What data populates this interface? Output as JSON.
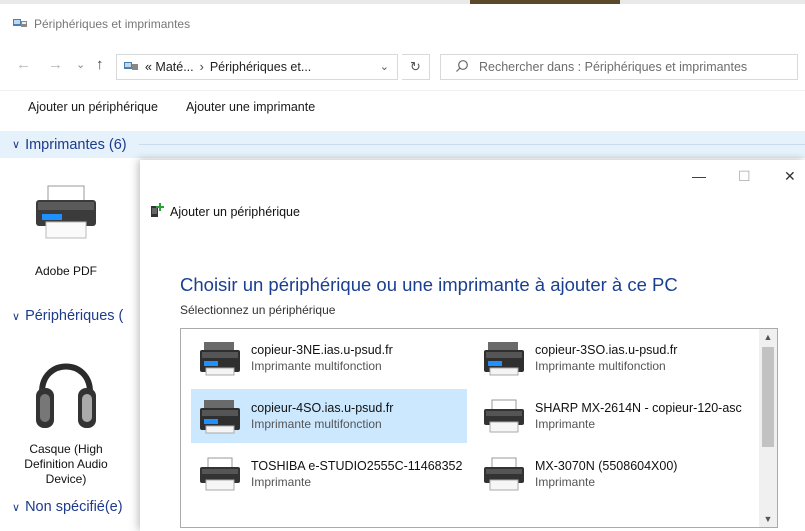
{
  "window": {
    "title": "Périphériques et imprimantes"
  },
  "nav": {
    "crumb_1": "« Maté...",
    "crumb_sep": "›",
    "crumb_2": "Périphériques et...",
    "search_placeholder": "Rechercher dans : Périphériques et imprimantes"
  },
  "commands": {
    "add_device": "Ajouter un périphérique",
    "add_printer": "Ajouter une imprimante"
  },
  "groups": {
    "printers": "Imprimantes (6)",
    "devices": "Périphériques (",
    "unspecified": "Non spécifié(e)"
  },
  "tiles": {
    "adobe_pdf": "Adobe PDF",
    "headset_1": "Casque (High",
    "headset_2": "Definition Audio",
    "headset_3": "Device)"
  },
  "dialog": {
    "title": "Ajouter un périphérique",
    "heading": "Choisir un périphérique ou une imprimante à ajouter à ce PC",
    "subtitle": "Sélectionnez un périphérique",
    "devices": [
      {
        "name": "copieur-3NE.ias.u-psud.fr",
        "kind": "Imprimante multifonction",
        "icon": "mfp-printer-icon",
        "selected": false
      },
      {
        "name": "copieur-3SO.ias.u-psud.fr",
        "kind": "Imprimante multifonction",
        "icon": "mfp-printer-icon",
        "selected": false
      },
      {
        "name": "copieur-4SO.ias.u-psud.fr",
        "kind": "Imprimante multifonction",
        "icon": "mfp-printer-icon",
        "selected": true
      },
      {
        "name": "SHARP MX-2614N - copieur-120-asc",
        "kind": "Imprimante",
        "icon": "printer-icon",
        "selected": false
      },
      {
        "name": "TOSHIBA e-STUDIO2555C-11468352",
        "kind": "Imprimante",
        "icon": "printer-icon",
        "selected": false
      },
      {
        "name": "MX-3070N (5508604X00)",
        "kind": "Imprimante",
        "icon": "printer-icon",
        "selected": false
      }
    ]
  },
  "colors": {
    "accent_heading": "#1b3f8f",
    "selection": "#cce8ff",
    "group_header_bg": "#e5f1fb"
  }
}
